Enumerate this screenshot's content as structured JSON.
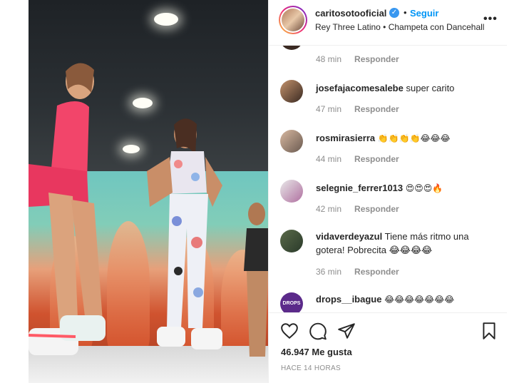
{
  "post": {
    "username": "caritosotooficial",
    "separator": "•",
    "follow_label": "Seguir",
    "verified_mark": "✓",
    "audio": "Rey Three Latino • Champeta con Dancehall",
    "more_label": "•••"
  },
  "comments": [
    {
      "user": "",
      "text": "",
      "time": "48 min",
      "reply": "Responder"
    },
    {
      "user": "josefajacomesalebe",
      "text": "super carito",
      "time": "47 min",
      "reply": "Responder"
    },
    {
      "user": "rosmirasierra",
      "text": "👏👏👏👏😂😂😂",
      "time": "44 min",
      "reply": "Responder"
    },
    {
      "user": "selegnie_ferrer1013",
      "text": "😍😍😍🔥",
      "time": "42 min",
      "reply": "Responder"
    },
    {
      "user": "vidaverdeyazul",
      "text": "Tiene más ritmo una gotera! Pobrecita 😂😂😂😂",
      "time": "36 min",
      "reply": "Responder"
    },
    {
      "user": "drops__ibague",
      "text": "😂😂😂😂😂😂😂",
      "time": "",
      "reply": ""
    }
  ],
  "drops_avatar_text": "DROPS",
  "footer": {
    "likes": "46.947 Me gusta",
    "time": "HACE 14 HORAS"
  },
  "colors": {
    "accent": "#0095f6",
    "verified": "#3897f0",
    "text": "#262626",
    "muted": "#8e8e8e"
  }
}
